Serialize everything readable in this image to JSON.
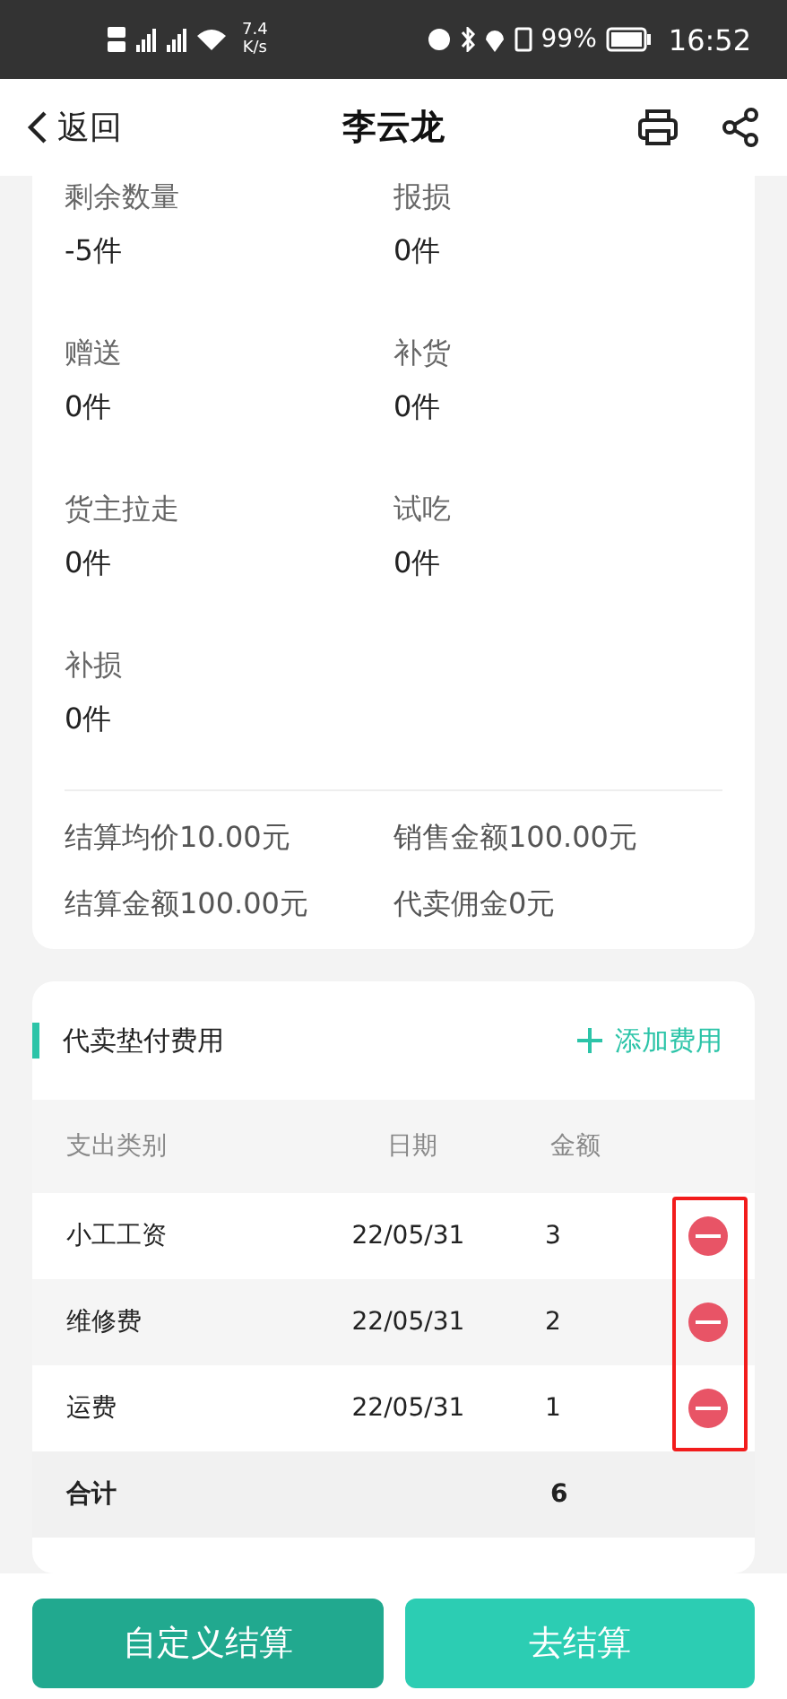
{
  "status_bar": {
    "speed_value": "7.4",
    "speed_unit": "K/s",
    "battery": "99%",
    "time": "16:52"
  },
  "header": {
    "back": "返回",
    "title": "李云龙"
  },
  "stats": [
    {
      "label": "剩余数量",
      "value": "-5件"
    },
    {
      "label": "报损",
      "value": "0件"
    },
    {
      "label": "赠送",
      "value": "0件"
    },
    {
      "label": "补货",
      "value": "0件"
    },
    {
      "label": "货主拉走",
      "value": "0件"
    },
    {
      "label": "试吃",
      "value": "0件"
    },
    {
      "label": "补损",
      "value": "0件"
    }
  ],
  "summary": [
    "结算均价10.00元",
    "销售金额100.00元",
    "结算金额100.00元",
    "代卖佣金0元"
  ],
  "expenses": {
    "title": "代卖垫付费用",
    "add_label": "添加费用",
    "highlighted_delete_column": true,
    "columns": [
      "支出类别",
      "日期",
      "金额"
    ],
    "rows": [
      {
        "category": "小工工资",
        "date": "22/05/31",
        "amount": "3"
      },
      {
        "category": "维修费",
        "date": "22/05/31",
        "amount": "2"
      },
      {
        "category": "运费",
        "date": "22/05/31",
        "amount": "1"
      }
    ],
    "total": {
      "label": "合计",
      "amount": "6"
    }
  },
  "buttons": [
    {
      "label": "自定义结算",
      "kind": "secondary"
    },
    {
      "label": "去结算",
      "kind": "primary"
    }
  ]
}
